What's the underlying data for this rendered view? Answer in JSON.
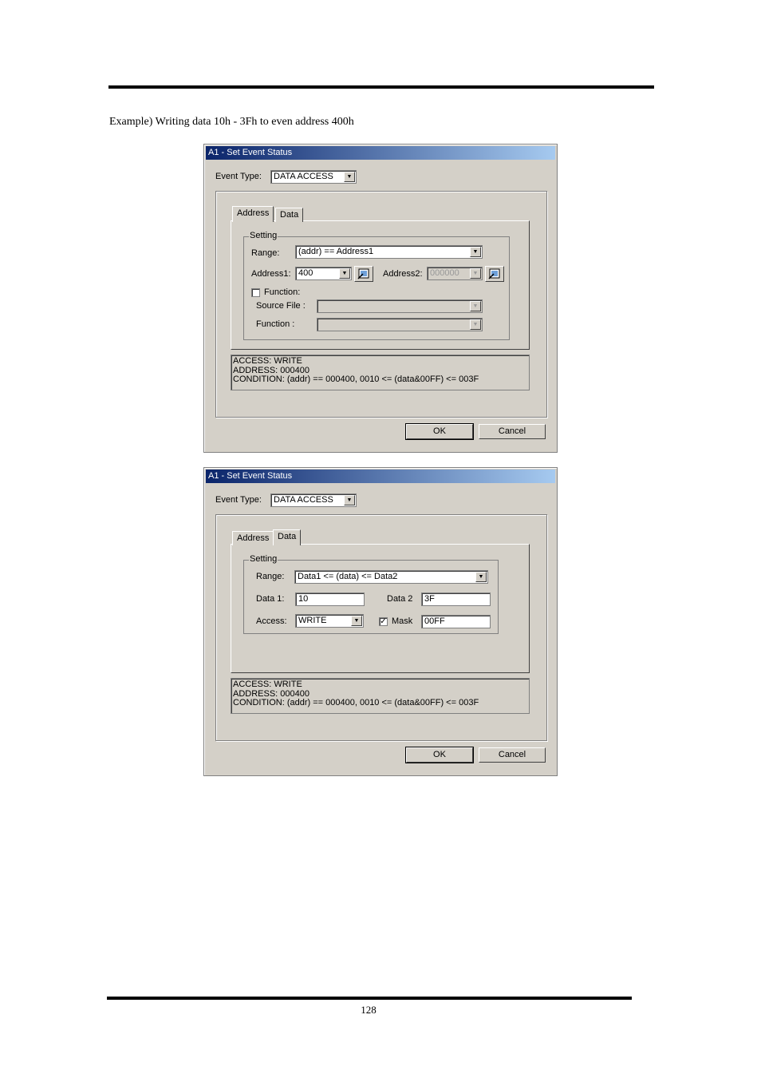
{
  "page": {
    "caption": "Example) Writing data 10h - 3Fh to even address 400h",
    "page_number": "128"
  },
  "dialog1": {
    "title": "A1 - Set Event Status",
    "event_type_label": "Event Type:",
    "event_type_value": "DATA ACCESS",
    "tabs": [
      "Address",
      "Data"
    ],
    "setting_label": "Setting",
    "range_label": "Range:",
    "range_value": "(addr) == Address1",
    "address1_label": "Address1:",
    "address1_value": "400",
    "address2_label": "Address2:",
    "address2_value": "000000",
    "function_checkbox_label": "Function:",
    "source_file_label": "Source File :",
    "function_label": "Function :",
    "status_lines": [
      "ACCESS: WRITE",
      "ADDRESS: 000400",
      "CONDITION: (addr) == 000400, 0010 <= (data&00FF) <= 003F"
    ],
    "ok_label": "OK",
    "cancel_label": "Cancel"
  },
  "dialog2": {
    "title": "A1 - Set Event Status",
    "event_type_label": "Event Type:",
    "event_type_value": "DATA ACCESS",
    "tabs": [
      "Address",
      "Data"
    ],
    "setting_label": "Setting",
    "range_label": "Range:",
    "range_value": "Data1 <= (data) <= Data2",
    "data1_label": "Data 1:",
    "data1_value": "10",
    "data2_label": "Data 2",
    "data2_value": "3F",
    "access_label": "Access:",
    "access_value": "WRITE",
    "mask_label": "Mask",
    "mask_value": "00FF",
    "mask_check": "✓",
    "status_lines": [
      "ACCESS: WRITE",
      "ADDRESS: 000400",
      "CONDITION: (addr) == 000400, 0010 <= (data&00FF) <= 003F"
    ],
    "ok_label": "OK",
    "cancel_label": "Cancel"
  },
  "icons": {
    "dropdown": "▼",
    "browse": "browse-memory-icon"
  }
}
